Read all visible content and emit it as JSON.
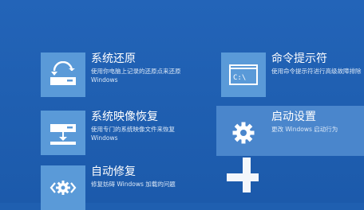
{
  "options": [
    {
      "id": "system-restore",
      "icon": "system-restore-icon",
      "title": "系统还原",
      "desc_line1": "使用你电脑上记录的还原点来还原",
      "desc_line2": "Windows"
    },
    {
      "id": "command-prompt",
      "icon": "command-prompt-icon",
      "title": "命令提示符",
      "desc_line1": "使用命令提示符进行高级故障排除",
      "desc_line2": ""
    },
    {
      "id": "system-image-recovery",
      "icon": "system-image-recovery-icon",
      "title": "系统映像恢复",
      "desc_line1": "使用专门的系统映像文件来恢复",
      "desc_line2": "Windows"
    },
    {
      "id": "startup-settings",
      "icon": "gear-icon",
      "title": "启动设置",
      "desc_line1": "更改 Windows 启动行为",
      "desc_line2": ""
    },
    {
      "id": "startup-repair",
      "icon": "startup-repair-icon",
      "title": "自动修复",
      "desc_line1": "修复妨碍 Windows 加载的问题",
      "desc_line2": ""
    }
  ],
  "colors": {
    "background": "#1f5fb0",
    "tile_icon": "#5a9ad8",
    "highlight": "#4a86cc"
  }
}
